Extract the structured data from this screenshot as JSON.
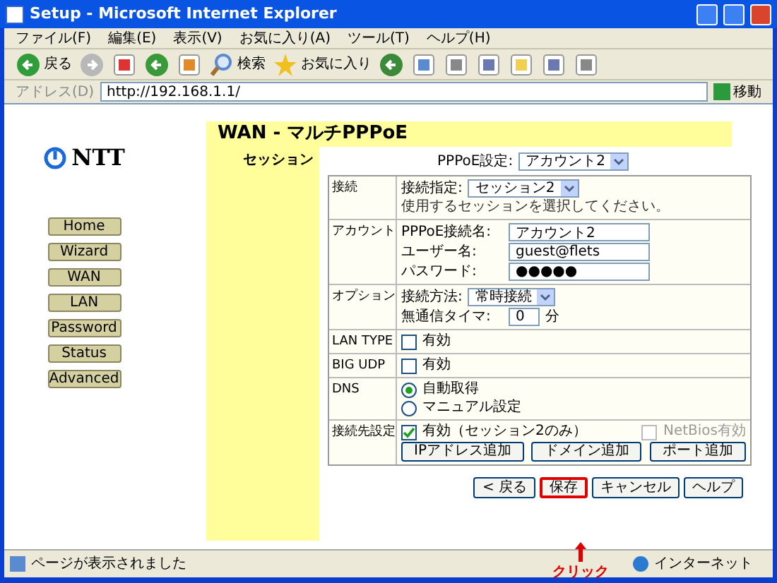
{
  "window": {
    "title": "Setup - Microsoft Internet Explorer"
  },
  "menu": [
    "ファイル(F)",
    "編集(E)",
    "表示(V)",
    "お気に入り(A)",
    "ツール(T)",
    "ヘルプ(H)"
  ],
  "toolbar": [
    {
      "kind": "back",
      "label": "戻る"
    },
    {
      "kind": "forward"
    },
    {
      "kind": "stop"
    },
    {
      "kind": "refresh"
    },
    {
      "kind": "home"
    },
    {
      "kind": "search",
      "label": "検索"
    },
    {
      "kind": "favorites",
      "label": "お気に入り"
    },
    {
      "kind": "media"
    },
    {
      "kind": "mail"
    },
    {
      "kind": "print"
    },
    {
      "kind": "edit"
    },
    {
      "kind": "folder"
    },
    {
      "kind": "research"
    },
    {
      "kind": "messenger"
    }
  ],
  "address": {
    "label": "アドレス(D)",
    "url": "http://192.168.1.1/",
    "go": "移動"
  },
  "logo": "NTT",
  "nav": [
    "Home",
    "Wizard",
    "WAN",
    "LAN",
    "Password",
    "Status",
    "Advanced"
  ],
  "page": {
    "title": "WAN - マルチPPPoE",
    "session_label": "セッション",
    "pppoe_setting": {
      "label": "PPPoE設定:",
      "value": "アカウント2"
    }
  },
  "rows": [
    {
      "label": "接続",
      "lines": [
        [
          {
            "kind": "select",
            "label": "接続指定:",
            "value": "セッション2"
          }
        ],
        [
          {
            "kind": "hint",
            "label": "使用するセッションを選択してください。"
          }
        ]
      ]
    },
    {
      "label": "アカウント",
      "lines": [
        [
          {
            "kind": "input",
            "label": "PPPoE接続名:",
            "value": "アカウント2"
          }
        ],
        [
          {
            "kind": "input",
            "label": "ユーザー名:",
            "value": "guest@flets"
          }
        ],
        [
          {
            "kind": "input",
            "label": "パスワード:",
            "value": "●●●●●"
          }
        ]
      ]
    },
    {
      "label": "オプション",
      "lines": [
        [
          {
            "kind": "select",
            "label": "接続方法:",
            "value": "常時接続"
          }
        ],
        [
          {
            "kind": "input",
            "label": "無通信タイマ:",
            "value": "0",
            "suffix": "分"
          }
        ]
      ]
    },
    {
      "label": "LAN TYPE",
      "lines": [
        [
          {
            "kind": "checkbox",
            "label": "有効",
            "checked": false,
            "disabled": false
          }
        ]
      ]
    },
    {
      "label": "BIG UDP",
      "lines": [
        [
          {
            "kind": "checkbox",
            "label": "有効",
            "checked": false,
            "disabled": false
          }
        ]
      ]
    },
    {
      "label": "DNS",
      "lines": [
        [
          {
            "kind": "radio",
            "label": "自動取得",
            "selected": true
          }
        ],
        [
          {
            "kind": "radio",
            "label": "マニュアル設定",
            "selected": false
          }
        ]
      ]
    },
    {
      "label": "接続先設定",
      "lines": [
        [
          {
            "kind": "checkbox",
            "label": "有効（セッション2のみ）",
            "checked": true,
            "disabled": false
          },
          {
            "kind": "checkbox",
            "label": "NetBios有効",
            "checked": false,
            "disabled": true
          }
        ],
        [
          {
            "kind": "button",
            "label": "IPアドレス追加"
          },
          {
            "kind": "button",
            "label": "ドメイン追加"
          },
          {
            "kind": "button",
            "label": "ポート追加"
          }
        ]
      ]
    }
  ],
  "actions": [
    {
      "label": "< 戻る",
      "highlighted": false
    },
    {
      "label": "保存",
      "highlighted": true
    },
    {
      "label": "キャンセル",
      "highlighted": false
    },
    {
      "label": "ヘルプ",
      "highlighted": false
    }
  ],
  "annotation": {
    "label": "クリック"
  },
  "status_bar": {
    "text": "ページが表示されました",
    "zone": "インターネット"
  }
}
